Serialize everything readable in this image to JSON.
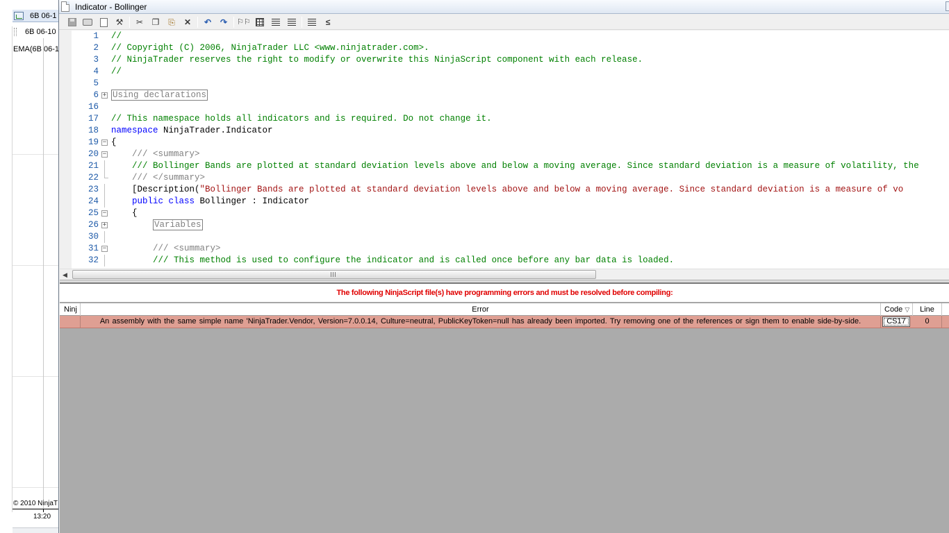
{
  "background_chart": {
    "tab_label": "6B 06-1",
    "instrument_label": "6B 06-10",
    "indicator_label": "EMA(6B 06-1",
    "copyright": "© 2010 NinjaT",
    "time_label": "13:20"
  },
  "window": {
    "title": "Indicator - Bollinger"
  },
  "toolbar": {
    "buttons": [
      "save-icon",
      "print-icon",
      "print-preview-icon",
      "page-setup-icon",
      "cut-icon",
      "copy-icon",
      "paste-icon",
      "delete-icon",
      "undo-icon",
      "redo-icon",
      "find-icon",
      "find-replace-icon",
      "indent-icon",
      "outdent-icon",
      "comment-icon",
      "uncomment-icon"
    ]
  },
  "code": {
    "lines": [
      {
        "num": "1",
        "fold": "",
        "segments": [
          {
            "t": "//",
            "c": "c-comment"
          }
        ]
      },
      {
        "num": "2",
        "fold": "",
        "segments": [
          {
            "t": "// Copyright (C) 2006, NinjaTrader LLC <www.ninjatrader.com>.",
            "c": "c-comment"
          }
        ]
      },
      {
        "num": "3",
        "fold": "",
        "segments": [
          {
            "t": "// NinjaTrader reserves the right to modify or overwrite this NinjaScript component with each release.",
            "c": "c-comment"
          }
        ]
      },
      {
        "num": "4",
        "fold": "",
        "segments": [
          {
            "t": "//",
            "c": "c-comment"
          }
        ]
      },
      {
        "num": "5",
        "fold": "",
        "segments": []
      },
      {
        "num": "6",
        "fold": "+",
        "segments": [
          {
            "t": "Using declarations",
            "c": "c-region"
          }
        ]
      },
      {
        "num": "16",
        "fold": "",
        "segments": []
      },
      {
        "num": "17",
        "fold": "",
        "segments": [
          {
            "t": "// This namespace holds all indicators and is required. Do not change it.",
            "c": "c-comment"
          }
        ]
      },
      {
        "num": "18",
        "fold": "",
        "segments": [
          {
            "t": "namespace",
            "c": "c-keyword"
          },
          {
            "t": " NinjaTrader.Indicator",
            "c": "c-plain"
          }
        ]
      },
      {
        "num": "19",
        "fold": "-",
        "segments": [
          {
            "t": "{",
            "c": "c-plain"
          }
        ]
      },
      {
        "num": "20",
        "fold": "-",
        "segments": [
          {
            "t": "    /// <summary>",
            "c": "c-xmldoc"
          }
        ]
      },
      {
        "num": "21",
        "fold": "|",
        "segments": [
          {
            "t": "    /// Bollinger Bands are plotted at standard deviation levels above and below a moving average. Since standard deviation is a measure of volatility, the",
            "c": "c-comment"
          }
        ]
      },
      {
        "num": "22",
        "fold": "L",
        "segments": [
          {
            "t": "    /// </summary>",
            "c": "c-xmldoc"
          }
        ]
      },
      {
        "num": "23",
        "fold": "|",
        "segments": [
          {
            "t": "    [Description(",
            "c": "c-plain"
          },
          {
            "t": "\"Bollinger Bands are plotted at standard deviation levels above and below a moving average. Since standard deviation is a measure of vo",
            "c": "c-string"
          }
        ]
      },
      {
        "num": "24",
        "fold": "|",
        "segments": [
          {
            "t": "    ",
            "c": "c-plain"
          },
          {
            "t": "public class",
            "c": "c-keyword"
          },
          {
            "t": " Bollinger : Indicator",
            "c": "c-plain"
          }
        ]
      },
      {
        "num": "25",
        "fold": "-",
        "segments": [
          {
            "t": "    {",
            "c": "c-plain"
          }
        ]
      },
      {
        "num": "26",
        "fold": "+",
        "segments": [
          {
            "t": "        ",
            "c": "c-plain"
          },
          {
            "t": "Variables",
            "c": "c-region"
          }
        ]
      },
      {
        "num": "30",
        "fold": "|",
        "segments": []
      },
      {
        "num": "31",
        "fold": "-",
        "segments": [
          {
            "t": "        /// <summary>",
            "c": "c-xmldoc"
          }
        ]
      },
      {
        "num": "32",
        "fold": "|",
        "segments": [
          {
            "t": "        /// This method is used to configure the indicator and is called once before any bar data is loaded.",
            "c": "c-comment"
          }
        ]
      }
    ]
  },
  "errors": {
    "banner": "The following NinjaScript file(s) have programming errors and must be resolved before compiling:",
    "headers": {
      "ninja": "Ninj",
      "error": "Error",
      "code": "Code",
      "code_sort": "▽",
      "line": "Line"
    },
    "rows": [
      {
        "ninja": "",
        "error": "An assembly with the same simple name 'NinjaTrader.Vendor, Version=7.0.0.14, Culture=neutral, PublicKeyToken=null has already been imported. Try removing one of the references or sign them to enable side-by-side.",
        "code": "CS17",
        "line": "0"
      }
    ]
  },
  "colors": {
    "error_banner": "#e00000",
    "error_row_bg": "#df9f93",
    "panel_bg": "#ababab",
    "comment": "#008000",
    "keyword": "#0000ff",
    "string": "#a31515"
  }
}
